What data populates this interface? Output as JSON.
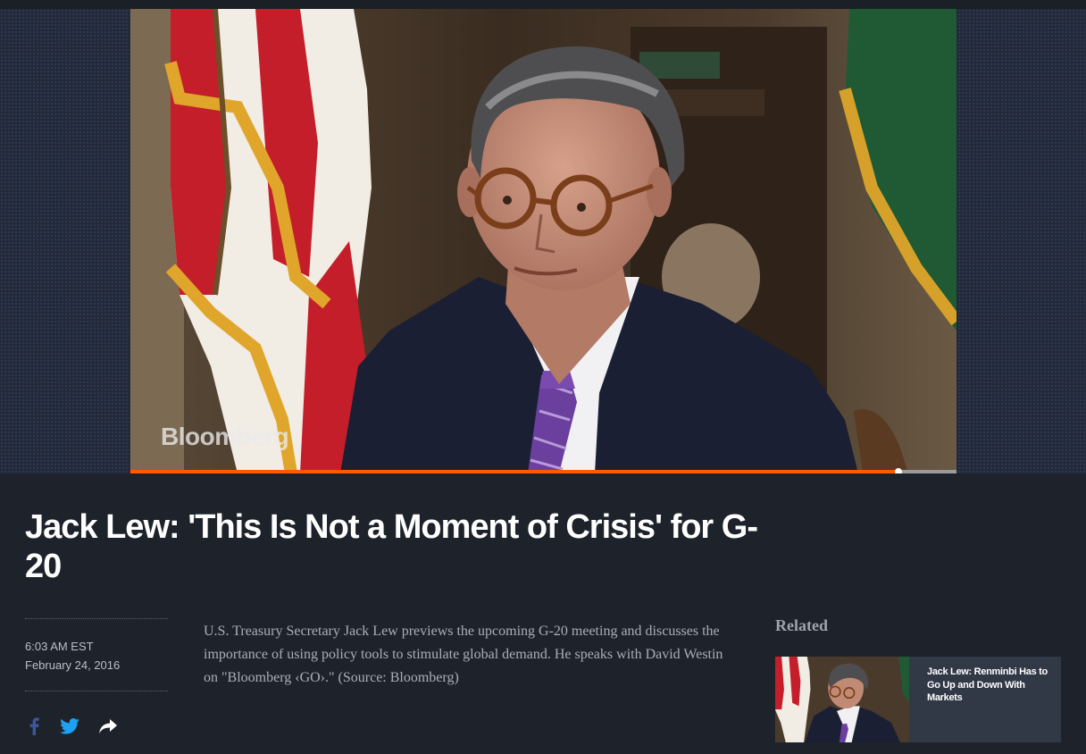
{
  "video": {
    "watermark": "Bloomberg",
    "progress": 0.93
  },
  "article": {
    "title": "Jack Lew: 'This Is Not a Moment of Crisis' for G-20",
    "time": "6:03 AM EST",
    "date": "February 24, 2016",
    "description": "U.S. Treasury Secretary Jack Lew previews the upcoming G-20 meeting and discusses the importance of using policy tools to stimulate global demand. He speaks with David Westin on \"Bloomberg ‹GO›.\" (Source: Bloomberg)"
  },
  "share": {
    "icons": [
      "facebook-icon",
      "twitter-icon",
      "share-arrow-icon"
    ],
    "colors": {
      "facebook": "#3b5998",
      "twitter": "#1da1f2",
      "share": "#ffffff"
    }
  },
  "related": {
    "heading": "Related",
    "items": [
      {
        "title": "Jack Lew: Renminbi Has to Go Up and Down With Markets"
      }
    ]
  },
  "colors": {
    "background": "#1e232b",
    "accent": "#ff5a00",
    "card": "#313846"
  }
}
